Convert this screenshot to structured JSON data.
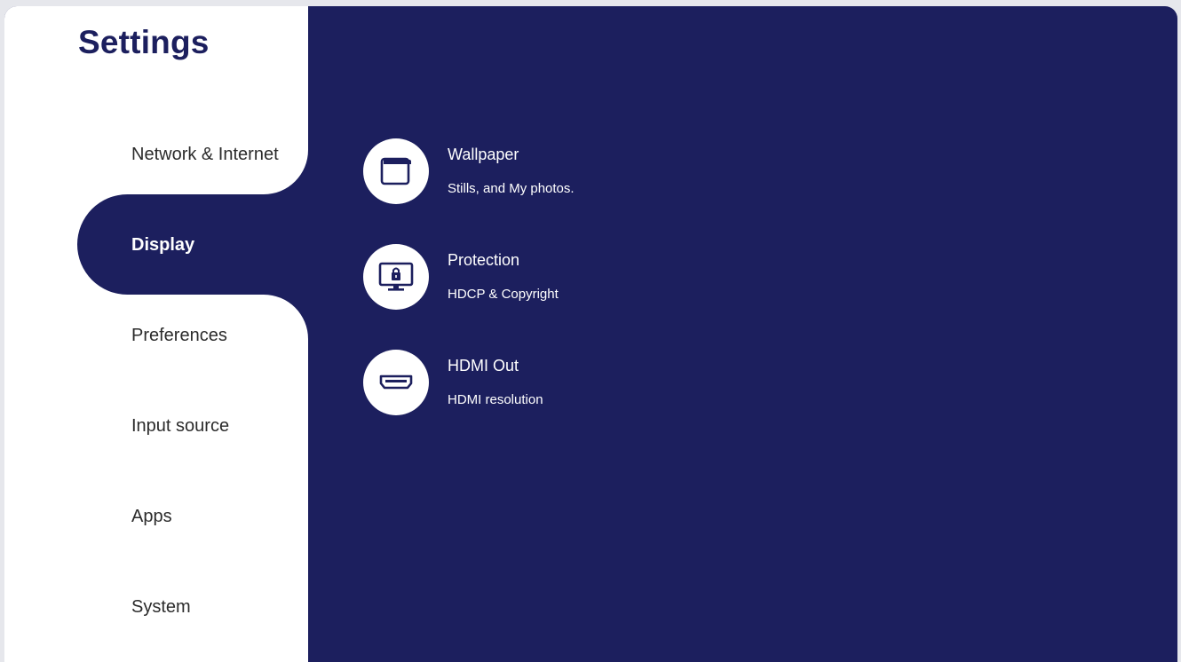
{
  "page": {
    "title": "Settings"
  },
  "sidebar": {
    "items": [
      {
        "label": "Network & Internet",
        "active": false
      },
      {
        "label": "Display",
        "active": true
      },
      {
        "label": "Preferences",
        "active": false
      },
      {
        "label": "Input source",
        "active": false
      },
      {
        "label": "Apps",
        "active": false
      },
      {
        "label": "System",
        "active": false
      }
    ]
  },
  "display": {
    "options": [
      {
        "title": "Wallpaper",
        "description": "Stills, and My photos.",
        "icon": "wallpaper-icon"
      },
      {
        "title": "Protection",
        "description": "HDCP & Copyright",
        "icon": "monitor-lock-icon"
      },
      {
        "title": "HDMI Out",
        "description": "HDMI resolution",
        "icon": "hdmi-port-icon"
      }
    ]
  },
  "colors": {
    "primary": "#1c1f5e",
    "surface": "#ffffff",
    "text": "#2b2b2b"
  }
}
